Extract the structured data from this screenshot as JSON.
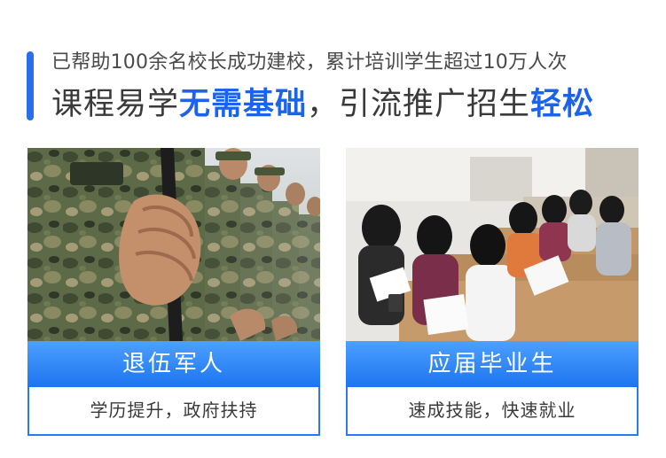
{
  "header": {
    "subline": "已帮助100余名校长成功建校，累计培训学生超过10万人次",
    "headline_part1": "课程易学",
    "headline_hl1": "无需基础",
    "headline_part2": "，引流推广招生",
    "headline_hl2": "轻松"
  },
  "cards": [
    {
      "label": "退伍军人",
      "desc": "学历提升，政府扶持"
    },
    {
      "label": "应届毕业生",
      "desc": "速成技能，快速就业"
    }
  ],
  "colors": {
    "accent": "#1a63ea",
    "label_bar_top": "#4da0ff",
    "label_bar_bottom": "#1c74f0",
    "text": "#3a3a3a"
  }
}
